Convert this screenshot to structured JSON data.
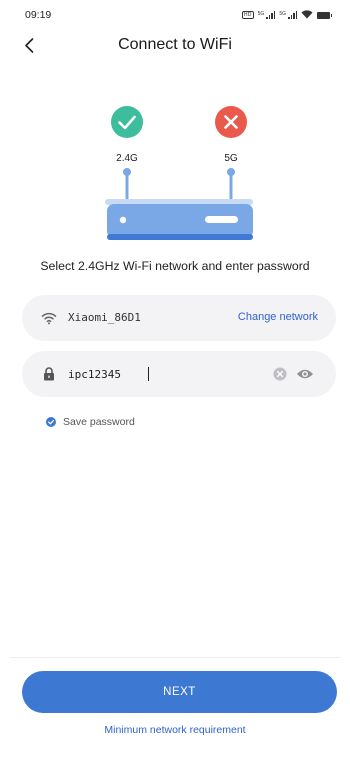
{
  "status_bar": {
    "time": "09:19",
    "hd_badge": "HD",
    "signal_1_label": "5G",
    "signal_2_label": "5G"
  },
  "header": {
    "title": "Connect to WiFi",
    "back_icon": "chevron-left-icon"
  },
  "illustration": {
    "band_supported": "2.4G",
    "band_unsupported": "5G",
    "supported_icon": "check-icon",
    "unsupported_icon": "close-icon",
    "colors": {
      "supported": "#3dbd9c",
      "unsupported": "#ea5a4c",
      "router_body": "#7aa8e6",
      "router_accent": "#3f7ad6"
    }
  },
  "instruction": "Select 2.4GHz Wi-Fi network and enter password",
  "network_field": {
    "icon": "wifi-icon",
    "ssid": "Xiaomi_86D1",
    "change_label": "Change network"
  },
  "password_field": {
    "icon": "lock-icon",
    "value": "ipc12345",
    "clear_icon": "clear-icon",
    "visibility_icon": "eye-icon"
  },
  "save_password": {
    "label": "Save password",
    "checked": true
  },
  "footer": {
    "next_label": "NEXT",
    "min_requirement_label": "Minimum network requirement"
  },
  "colors": {
    "accent": "#3d78d3",
    "link": "#2f62d0",
    "field_bg": "#f3f3f5"
  }
}
